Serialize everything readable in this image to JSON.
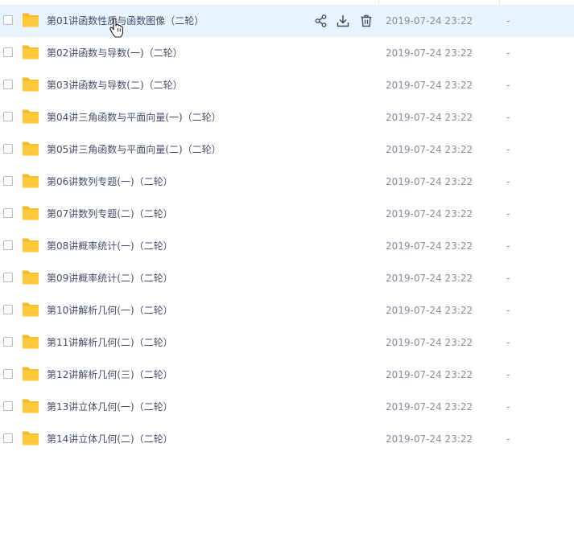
{
  "files": [
    {
      "name": "第01讲函数性质与函数图像（二轮）",
      "date": "2019-07-24 23:22",
      "size": "-"
    },
    {
      "name": "第02讲函数与导数(一)（二轮）",
      "date": "2019-07-24 23:22",
      "size": "-"
    },
    {
      "name": "第03讲函数与导数(二)（二轮）",
      "date": "2019-07-24 23:22",
      "size": "-"
    },
    {
      "name": "第04讲三角函数与平面向量(一)（二轮）",
      "date": "2019-07-24 23:22",
      "size": "-"
    },
    {
      "name": "第05讲三角函数与平面向量(二)（二轮）",
      "date": "2019-07-24 23:22",
      "size": "-"
    },
    {
      "name": "第06讲数列专题(一)（二轮）",
      "date": "2019-07-24 23:22",
      "size": "-"
    },
    {
      "name": "第07讲数列专题(二)（二轮）",
      "date": "2019-07-24 23:22",
      "size": "-"
    },
    {
      "name": "第08讲概率统计(一)（二轮）",
      "date": "2019-07-24 23:22",
      "size": "-"
    },
    {
      "name": "第09讲概率统计(二)（二轮）",
      "date": "2019-07-24 23:22",
      "size": "-"
    },
    {
      "name": "第10讲解析几何(一)（二轮）",
      "date": "2019-07-24 23:22",
      "size": "-"
    },
    {
      "name": "第11讲解析几何(二)（二轮）",
      "date": "2019-07-24 23:22",
      "size": "-"
    },
    {
      "name": "第12讲解析几何(三)（二轮）",
      "date": "2019-07-24 23:22",
      "size": "-"
    },
    {
      "name": "第13讲立体几何(一)（二轮）",
      "date": "2019-07-24 23:22",
      "size": "-"
    },
    {
      "name": "第14讲立体几何(二)（二轮）",
      "date": "2019-07-24 23:22",
      "size": "-"
    }
  ],
  "hovered_row": 0,
  "row_actions": [
    "share-icon",
    "download-icon",
    "delete-icon"
  ],
  "colors": {
    "folder": "#ffc93c",
    "folder_back": "#f7b82b",
    "hover_row": "#e8f4fd",
    "icon": "#424e67"
  }
}
